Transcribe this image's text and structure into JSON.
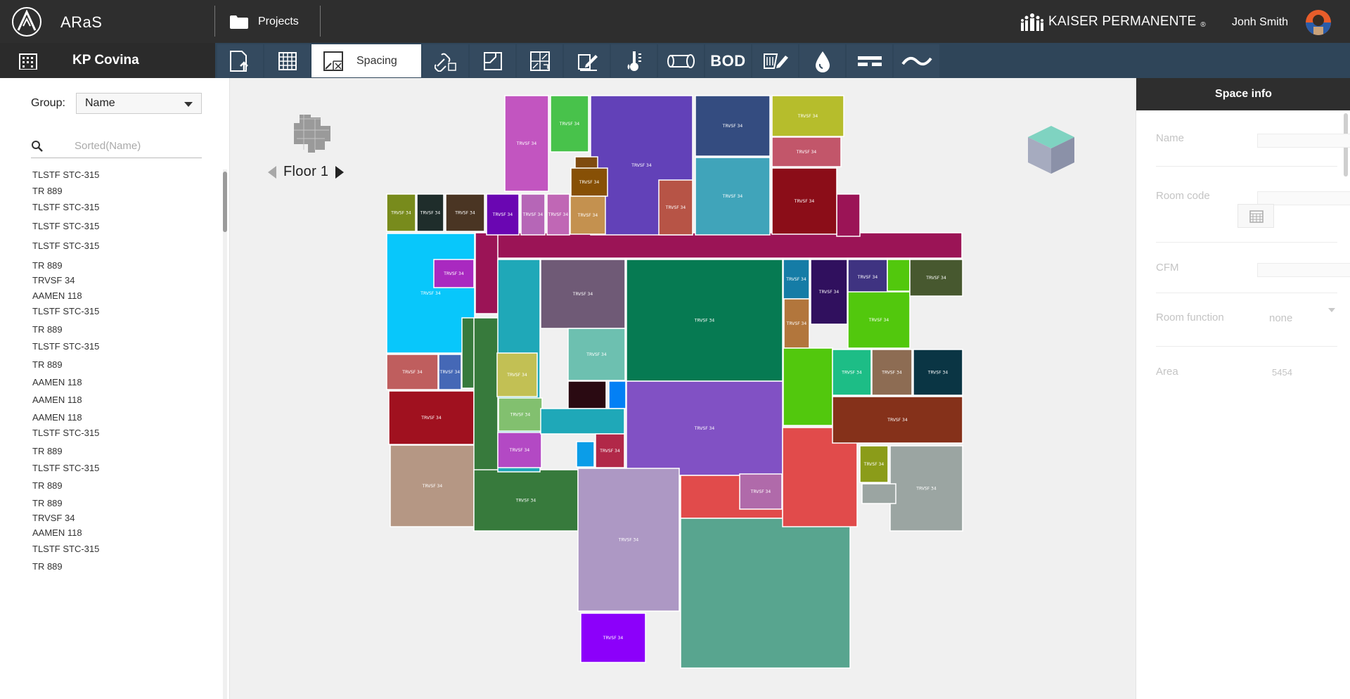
{
  "app": {
    "name": "ARaS"
  },
  "topbar": {
    "projects_label": "Projects",
    "brand_text": "KAISER PERMANENTE",
    "brand_reg": "®",
    "user_name": "Jonh Smith"
  },
  "subbar": {
    "site_name": "KP Covina",
    "tools": [
      {
        "name": "upload-tool",
        "icon": "file-upload-icon"
      },
      {
        "name": "grid-tool",
        "icon": "grid-icon"
      },
      {
        "name": "spacing-tool",
        "icon": "spacing-icon",
        "label": "Spacing",
        "active": true
      },
      {
        "name": "link-tool",
        "icon": "link-icon"
      },
      {
        "name": "floor-tool",
        "icon": "floor-plan-icon"
      },
      {
        "name": "layout-tool",
        "icon": "layout-icon"
      },
      {
        "name": "edit-tool",
        "icon": "edit-doc-icon"
      },
      {
        "name": "temperature-tool",
        "icon": "thermometer-icon"
      },
      {
        "name": "duct-tool",
        "icon": "duct-icon"
      },
      {
        "name": "bod-tool",
        "label": "BOD"
      },
      {
        "name": "equipment-tool",
        "icon": "equipment-icon"
      },
      {
        "name": "water-tool",
        "icon": "water-drop-icon"
      },
      {
        "name": "lines-tool",
        "icon": "lines-icon"
      },
      {
        "name": "wave-tool",
        "icon": "wave-icon"
      }
    ]
  },
  "sidebar": {
    "group_label": "Group:",
    "group_value": "Name",
    "search_placeholder": "Sorted(Name)",
    "rooms": [
      "TLSTF STC-315",
      "TR 889",
      "TLSTF STC-315",
      "TLSTF STC-315",
      "TLSTF STC-315",
      "TR 889",
      "TRVSF 34",
      "AAMEN 118",
      "TLSTF STC-315",
      "TR 889",
      "TLSTF STC-315",
      "TR 889",
      "AAMEN 118",
      "AAMEN 118",
      "AAMEN 118",
      "TLSTF STC-315",
      "TR 889",
      "TLSTF STC-315",
      "TR 889",
      "TR 889",
      "TRVSF 34",
      "AAMEN 118",
      "TLSTF STC-315",
      "TR 889"
    ]
  },
  "canvas": {
    "floor_label": "Floor 1",
    "room_tag": "TRVSF 34",
    "corridor_color": "#9b1456"
  },
  "info": {
    "title": "Space info",
    "name_label": "Name",
    "room_code_label": "Room code",
    "cfm_label": "CFM",
    "room_function_label": "Room function",
    "room_function_value": "none",
    "area_label": "Area",
    "area_value": "5454"
  }
}
